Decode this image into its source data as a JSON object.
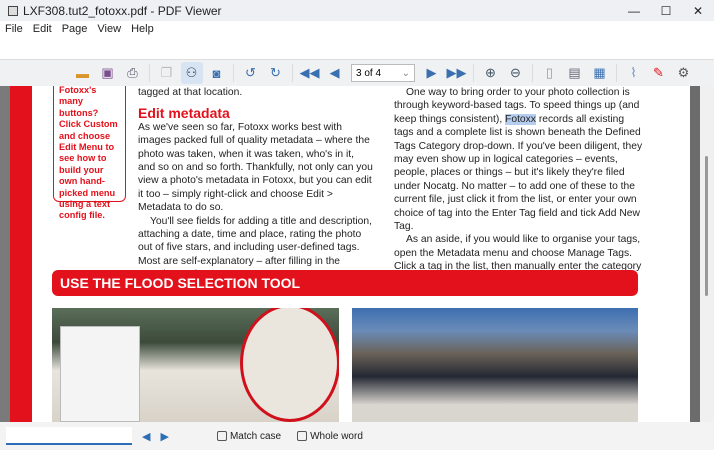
{
  "window": {
    "title": "LXF308.tut2_fotoxx.pdf - PDF Viewer",
    "minimize": "—",
    "maximize": "☐",
    "close": "✕"
  },
  "menu": [
    "File",
    "Edit",
    "Page",
    "View",
    "Help"
  ],
  "toolbar": {
    "page_selector": "3 of 4",
    "icons": [
      "open-folder",
      "save",
      "print",
      "copy",
      "find-binoculars",
      "page-setup",
      "rotate-left",
      "rotate-right",
      "first-page",
      "previous-page",
      "next-page",
      "last-page",
      "zoom-in",
      "zoom-out",
      "page",
      "fit-width",
      "fit-page",
      "attachment",
      "highlighter",
      "settings"
    ]
  },
  "document": {
    "tip": "Fotoxx's many buttons? Click Custom and choose Edit Menu to see how to build your own hand-picked menu using a text config file.",
    "col1_top": "tagged at that location.",
    "heading": "Edit metadata",
    "col1_p1": "As we've seen so far, Fotoxx works best with images packed full of quality metadata – where the photo was taken, when it was taken, who's in it, and so on and so forth. Thankfully, not only can you view a photo's metadata in Fotoxx, but you can edit it too – simply right-click and choose Edit > Metadata to do so.",
    "col1_p2": "You'll see fields for adding a title and description, attaching a date, time and place, rating the photo out of five stars, and including user-defined tags. Most are self-explanatory – after filling in the Location and",
    "col2_p1a": "One way to bring order to your photo collection is through keyword-based tags. To speed things up (and keep things consistent), ",
    "col2_highlight": "Fotoxx",
    "col2_p1b": " records all existing tags and a complete list is shown beneath the Defined Tags Category drop-down. If you've been diligent, they may even show up in logical categories – events, people, places or things – but it's likely they're filed under Nocatg. No matter – to add one of these to the current file, just click it from the list, or enter your own choice of tag into the Enter Tag field and tick Add New Tag.",
    "col2_p2": "As an aside, if you would like to organise your tags, open the Metadata menu and choose Manage Tags. Click a tag in the list, then manually enter the category",
    "banner": "USE THE FLOOD SELECTION TOOL"
  },
  "findbar": {
    "search_value": "",
    "match_case": "Match case",
    "whole_word": "Whole word",
    "match_case_checked": false,
    "whole_word_checked": false
  },
  "colors": {
    "accent_red": "#e3111b",
    "highlight": "#b5cdef",
    "toolbar_blue": "#3a6fb0"
  }
}
